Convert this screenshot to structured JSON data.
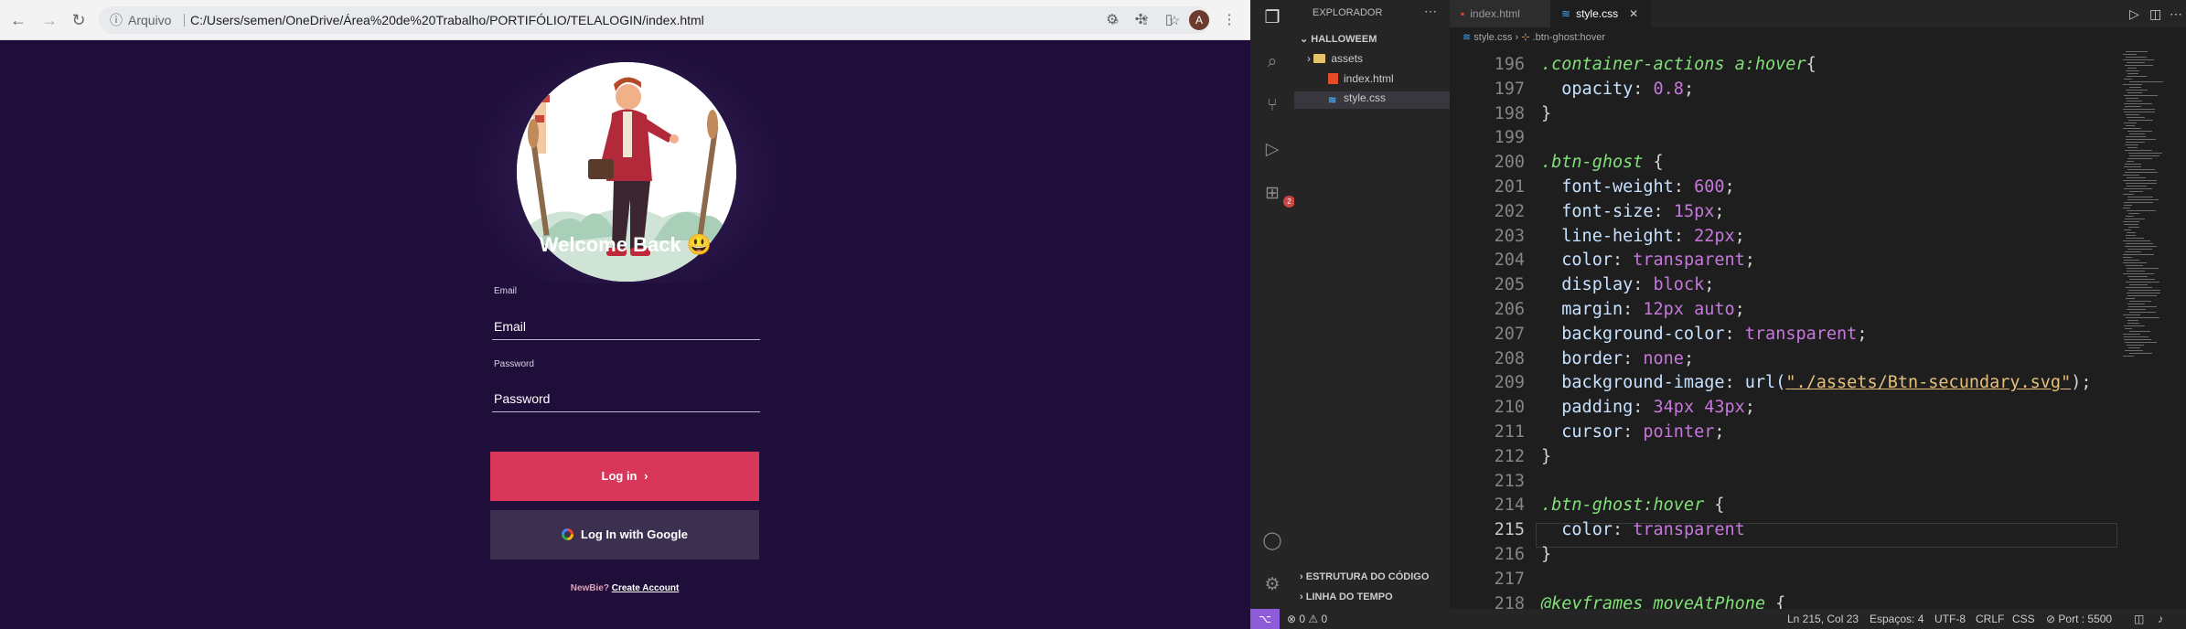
{
  "browser": {
    "address_label": "Arquivo",
    "url": "C:/Users/semen/OneDrive/Área%20de%20Trabalho/PORTIFÓLIO/TELALOGIN/index.html",
    "profile_initial": "A"
  },
  "login": {
    "welcome": "Welcome Back 😃",
    "email_label": "Email",
    "email_placeholder": "Email",
    "password_label": "Password",
    "password_placeholder": "Password",
    "login_button": "Log in",
    "login_chevron": "›",
    "google_button": "Log In with Google",
    "newbie_text": "NewBie?",
    "create_account": "Create Account"
  },
  "vscode": {
    "explorer_title": "EXPLORADOR",
    "folder_name": "HALLOWEEM",
    "tree": [
      "assets",
      "index.html",
      "style.css"
    ],
    "sections": [
      "ESTRUTURA DO CÓDIGO",
      "LINHA DO TEMPO"
    ],
    "tabs": [
      "index.html",
      "style.css"
    ],
    "breadcrumb_file": "style.css",
    "breadcrumb_symbol": ".btn-ghost:hover",
    "extensions_badge": "2",
    "line_numbers": [
      "196",
      "197",
      "198",
      "199",
      "200",
      "201",
      "202",
      "203",
      "204",
      "205",
      "206",
      "207",
      "208",
      "209",
      "210",
      "211",
      "212",
      "213",
      "214",
      "215",
      "216",
      "217",
      "218"
    ],
    "code": [
      {
        "sel": ".container-actions a:hover",
        "rest": "{"
      },
      {
        "prop": "opacity",
        "val": "0.8",
        "end": ";"
      },
      {
        "plain": "}"
      },
      {
        "plain": ""
      },
      {
        "sel": ".btn-ghost",
        "rest": " {"
      },
      {
        "prop": "font-weight",
        "val": "600",
        "end": ";"
      },
      {
        "prop": "font-size",
        "val": "15px",
        "end": ";"
      },
      {
        "prop": "line-height",
        "val": "22px",
        "end": ";"
      },
      {
        "prop": "color",
        "val": "transparent",
        "end": ";"
      },
      {
        "prop": "display",
        "val": "block",
        "end": ";"
      },
      {
        "prop": "margin",
        "val": "12px auto",
        "end": ";"
      },
      {
        "prop": "background-color",
        "val": "transparent",
        "end": ";"
      },
      {
        "prop": "border",
        "val": "none",
        "end": ";"
      },
      {
        "prop": "background-image",
        "func": "url(",
        "str": "\"./assets/Btn-secundary.svg\"",
        "end": ");"
      },
      {
        "prop": "padding",
        "val": "34px 43px",
        "end": ";"
      },
      {
        "prop": "cursor",
        "val": "pointer",
        "end": ";"
      },
      {
        "plain": "}"
      },
      {
        "plain": ""
      },
      {
        "sel": ".btn-ghost:hover",
        "rest": " {"
      },
      {
        "prop": "color",
        "val": "transparent",
        "end": ""
      },
      {
        "plain": "}"
      },
      {
        "plain": ""
      },
      {
        "sel": "@keyframes moveAtPhone",
        "rest": " {"
      }
    ],
    "status": {
      "problems": "⊗ 0 ⚠ 0",
      "position": "Ln 215, Col 23",
      "spaces": "Espaços: 4",
      "encoding": "UTF-8",
      "eol": "CRLF",
      "language": "CSS",
      "port": "⊘ Port : 5500"
    }
  }
}
